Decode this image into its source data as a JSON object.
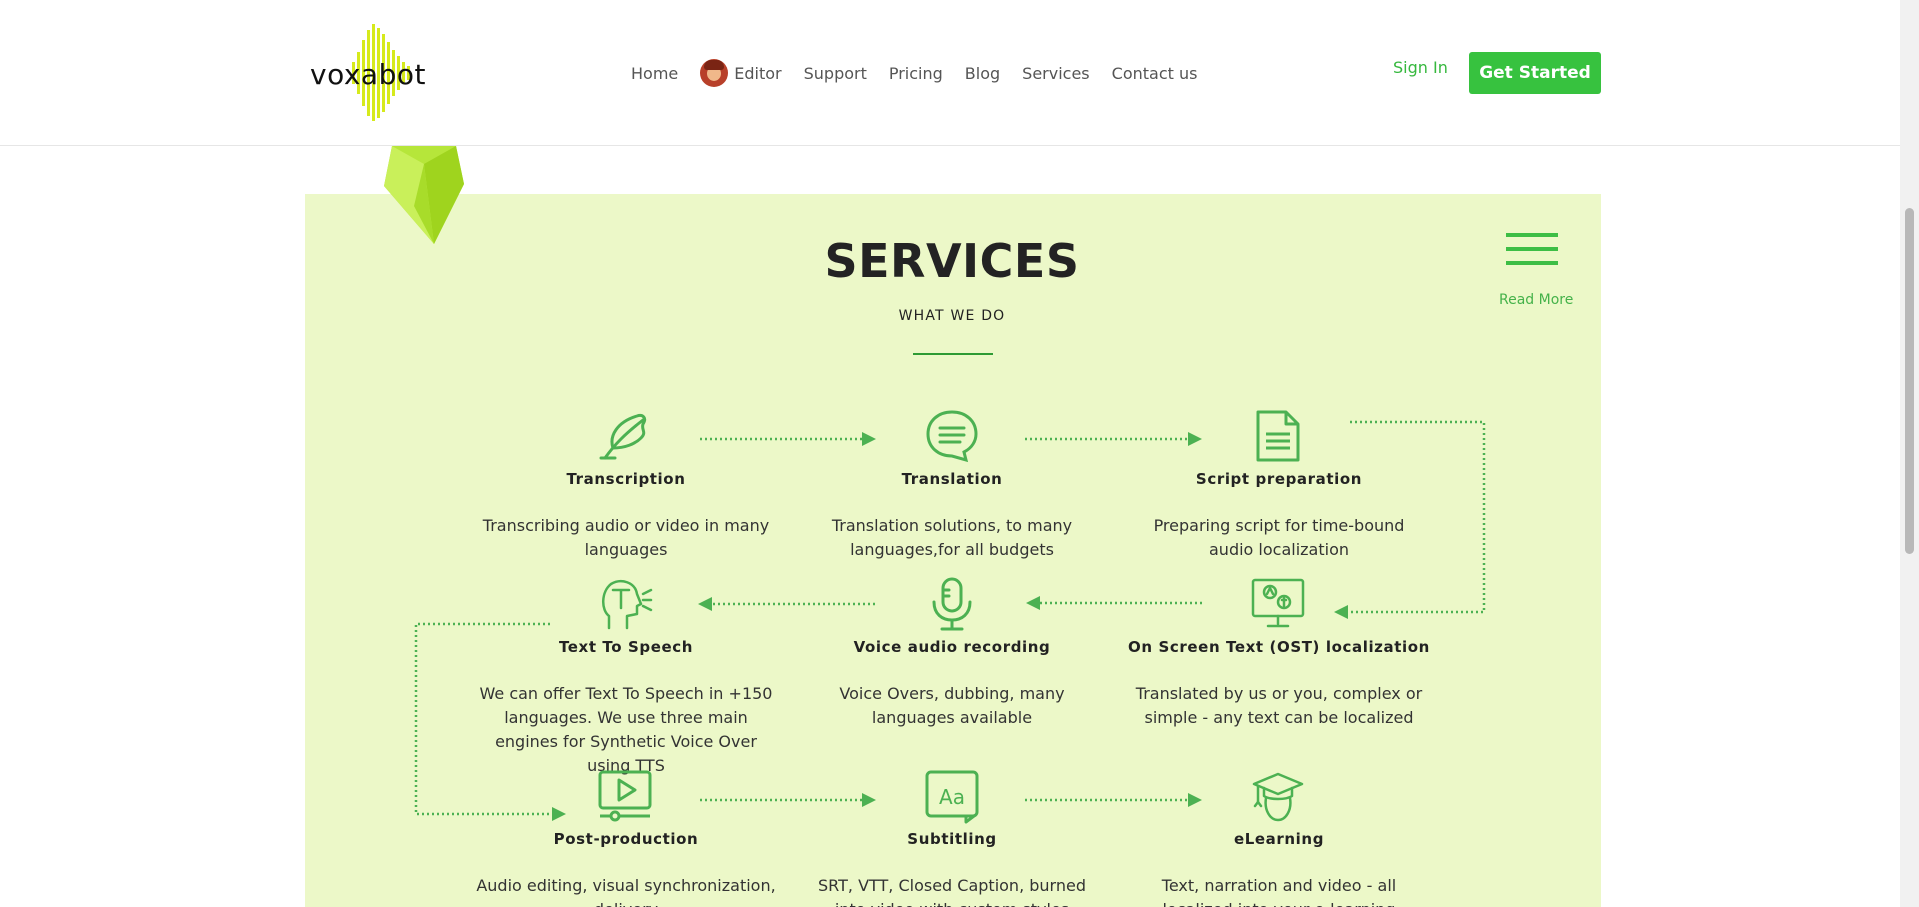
{
  "brand": {
    "name": "voxabot"
  },
  "nav": {
    "items": [
      {
        "label": "Home"
      },
      {
        "label": "Editor"
      },
      {
        "label": "Support"
      },
      {
        "label": "Pricing"
      },
      {
        "label": "Blog"
      },
      {
        "label": "Services"
      },
      {
        "label": "Contact us"
      }
    ],
    "sign_in": "Sign In",
    "get_started": "Get Started"
  },
  "section": {
    "title": "SERVICES",
    "subtitle": "WHAT WE DO",
    "read_more": "Read More"
  },
  "services": [
    {
      "name": "Transcription",
      "desc": "Transcribing audio or video in many languages",
      "icon": "feather-icon"
    },
    {
      "name": "Translation",
      "desc": "Translation solutions, to many languages,for all budgets",
      "icon": "speech-bubble-icon"
    },
    {
      "name": "Script preparation",
      "desc": "Preparing script for time-bound audio localization",
      "icon": "document-icon"
    },
    {
      "name": "Text To Speech",
      "desc": "We can offer Text To Speech in +150 languages. We use three main engines for Synthetic Voice Over using TTS",
      "icon": "speaking-head-icon"
    },
    {
      "name": "Voice audio recording",
      "desc": "Voice Overs, dubbing, many languages available",
      "icon": "microphone-icon"
    },
    {
      "name": "On Screen Text (OST) localization",
      "desc": "Translated by us or you, complex or simple - any text can be localized",
      "icon": "monitor-text-icon"
    },
    {
      "name": "Post-production",
      "desc": "Audio editing, visual synchronization, delivery",
      "icon": "video-player-icon"
    },
    {
      "name": "Subtitling",
      "desc": "SRT, VTT, Closed Caption, burned into video with custom styles",
      "icon": "subtitles-icon"
    },
    {
      "name": "eLearning",
      "desc": "Text, narration and video - all localized into your e-learning languages",
      "icon": "graduation-cap-icon"
    }
  ],
  "colors": {
    "accent": "#37c23f",
    "section_bg": "#ecf8c8",
    "icon": "#4cb152"
  }
}
